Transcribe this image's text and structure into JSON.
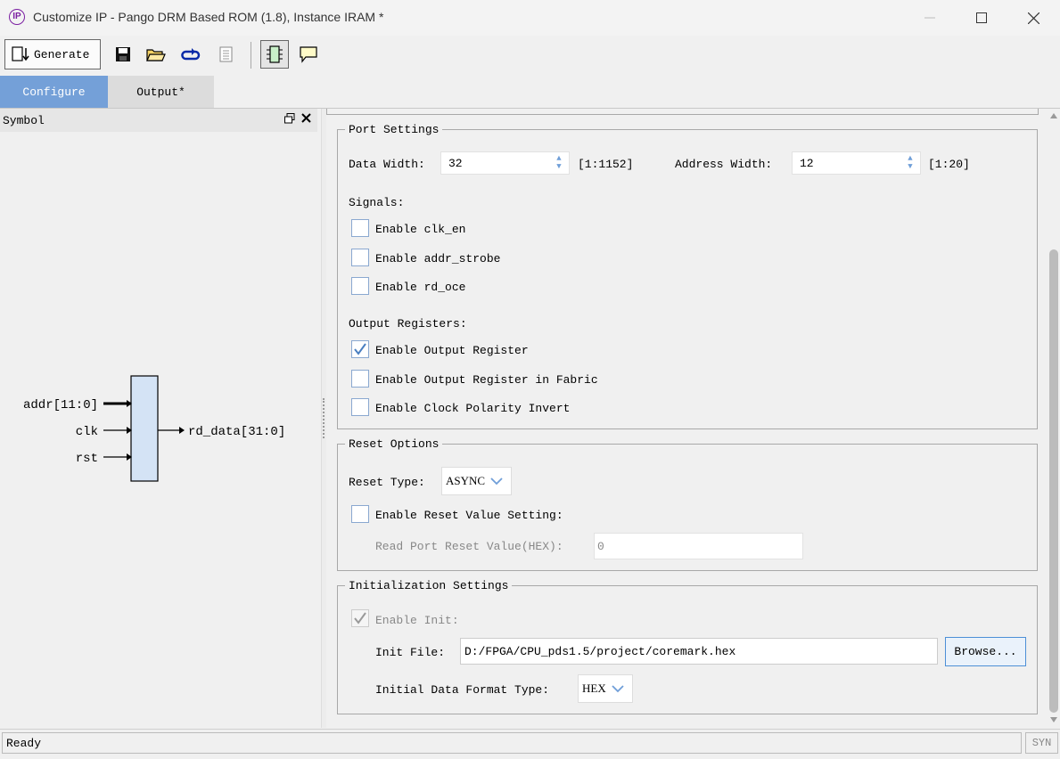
{
  "window": {
    "title": "Customize IP - Pango DRM Based ROM (1.8), Instance IRAM *",
    "app_icon": "IP"
  },
  "toolbar": {
    "generate_label": "Generate",
    "icons": [
      "save-icon",
      "open-folder-icon",
      "refresh-icon",
      "document-icon",
      "chip-icon",
      "comment-icon"
    ]
  },
  "tabs": [
    {
      "label": "Configure",
      "active": true
    },
    {
      "label": "Output*",
      "active": false
    }
  ],
  "symbol": {
    "title": "Symbol",
    "inputs": [
      "addr[11:0]",
      "clk",
      "rst"
    ],
    "output": "rd_data[31:0]"
  },
  "port_settings": {
    "legend": "Port Settings",
    "data_width_label": "Data Width:",
    "data_width_value": "32",
    "data_width_range": "[1:1152]",
    "address_width_label": "Address Width:",
    "address_width_value": "12",
    "address_width_range": "[1:20]",
    "signals_label": "Signals:",
    "signals": [
      {
        "label": "Enable clk_en",
        "checked": false
      },
      {
        "label": "Enable addr_strobe",
        "checked": false
      },
      {
        "label": "Enable rd_oce",
        "checked": false
      }
    ],
    "output_registers_label": "Output Registers:",
    "output_registers": [
      {
        "label": "Enable Output Register",
        "checked": true
      },
      {
        "label": "Enable Output Register in Fabric",
        "checked": false
      },
      {
        "label": "Enable Clock Polarity Invert",
        "checked": false
      }
    ]
  },
  "reset_options": {
    "legend": "Reset Options",
    "reset_type_label": "Reset Type:",
    "reset_type_value": "ASYNC",
    "enable_reset_value_label": "Enable Reset Value Setting:",
    "read_port_reset_label": "Read Port Reset Value(HEX):",
    "read_port_reset_value": "0"
  },
  "init_settings": {
    "legend": "Initialization Settings",
    "enable_init_label": "Enable Init:",
    "init_file_label": "Init File:",
    "init_file_value": "D:/FPGA/CPU_pds1.5/project/coremark.hex",
    "browse_label": "Browse...",
    "data_format_label": "Initial Data Format Type:",
    "data_format_value": "HEX"
  },
  "status": {
    "text": "Ready",
    "mode": "SYN"
  }
}
